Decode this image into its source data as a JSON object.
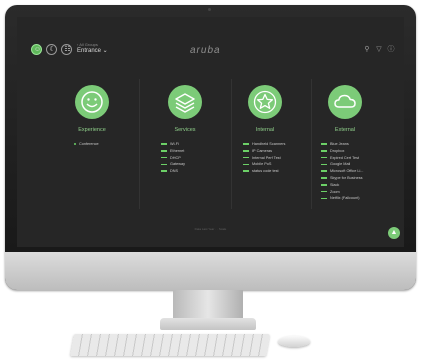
{
  "app": {
    "breadcrumb_small": "‹ All Groups",
    "breadcrumb_main": "Entrance ⌄",
    "brand": "aruba",
    "footer": "Data Last Year  ·  · Scale"
  },
  "header_icons": [
    "account-icon",
    "moon-icon",
    "search-icon",
    "filter-icon",
    "info-icon"
  ],
  "columns": [
    {
      "title": "Experience",
      "icon": "smiley-icon",
      "items": [
        "Conference"
      ]
    },
    {
      "title": "Services",
      "icon": "layers-icon",
      "items": [
        "Wi-Fi",
        "Ethernet",
        "DHCP",
        "Gateway",
        "DNS"
      ]
    },
    {
      "title": "Internal",
      "icon": "star-icon",
      "items": [
        "Handheld Scanners",
        "IP Cameras",
        "Internal Perf Test",
        "Mobile PoS",
        "status code test"
      ]
    },
    {
      "title": "External",
      "icon": "cloud-icon",
      "items": [
        "Blue Jeans",
        "Dropbox",
        "Expired Cert Test",
        "Google Mail",
        "Microsoft Office Li...",
        "Skype for Business",
        "Slack",
        "Zoom",
        "Netflix (Fallcount)"
      ]
    }
  ],
  "colors": {
    "accent": "#7ccb78",
    "screen_bg": "#262626",
    "bar": "#6cd067"
  }
}
